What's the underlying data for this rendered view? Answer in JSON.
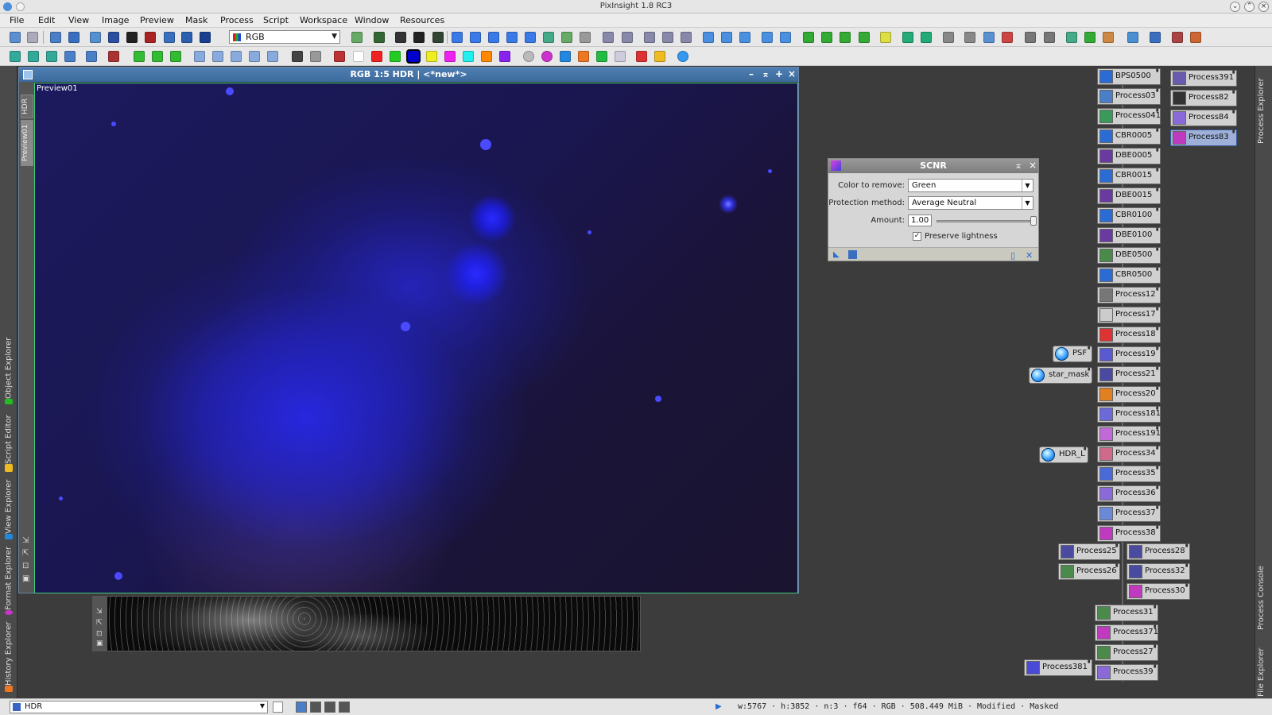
{
  "app": {
    "title": "PixInsight 1.8 RC3"
  },
  "menu": [
    "File",
    "Edit",
    "View",
    "Image",
    "Preview",
    "Mask",
    "Process",
    "Script",
    "Workspace",
    "Window",
    "Resources"
  ],
  "toolbar": {
    "channel_select": "RGB"
  },
  "image_window": {
    "title": "RGB 1:5 HDR | <*new*>",
    "tabs": [
      "HDR",
      "Preview01"
    ],
    "preview_label": "Preview01"
  },
  "left_dock": [
    "Object Explorer",
    "Script Editor",
    "View Explorer",
    "Format Explorer",
    "History Explorer"
  ],
  "right_dock": [
    "Process Explorer",
    "Process Console",
    "File Explorer"
  ],
  "scnr": {
    "title": "SCNR",
    "color_label": "Color to remove:",
    "color_value": "Green",
    "method_label": "Protection method:",
    "method_value": "Average Neutral",
    "amount_label": "Amount:",
    "amount_value": "1.00",
    "amount_fraction": 1.0,
    "preserve_label": "Preserve lightness",
    "preserve_checked": true
  },
  "process_icons": {
    "col1": [
      "BPS0500",
      "Process03",
      "Process041",
      "CBR0005",
      "DBE0005",
      "CBR0015",
      "DBE0015",
      "CBR0100",
      "DBE0100",
      "DBE0500",
      "CBR0500",
      "Process12",
      "Process17",
      "Process18",
      "Process19",
      "Process21",
      "Process20",
      "Process181",
      "Process191",
      "Process34",
      "Process35",
      "Process36",
      "Process37",
      "Process38"
    ],
    "col2": [
      "Process391",
      "Process82",
      "Process84",
      "Process83"
    ],
    "lower_left": [
      "Process25",
      "Process26"
    ],
    "lower_right": [
      "Process28",
      "Process32",
      "Process30"
    ],
    "lower_col": [
      "Process31",
      "Process371",
      "Process27",
      "Process39"
    ],
    "orphan": "Process381",
    "image_icons": [
      "PSF",
      "star_mask",
      "HDR_L"
    ]
  },
  "status": {
    "view": "HDR",
    "info": "w:5767 · h:3852 · n:3 · f64 · RGB · 508.449 MiB · Modified · Masked"
  }
}
